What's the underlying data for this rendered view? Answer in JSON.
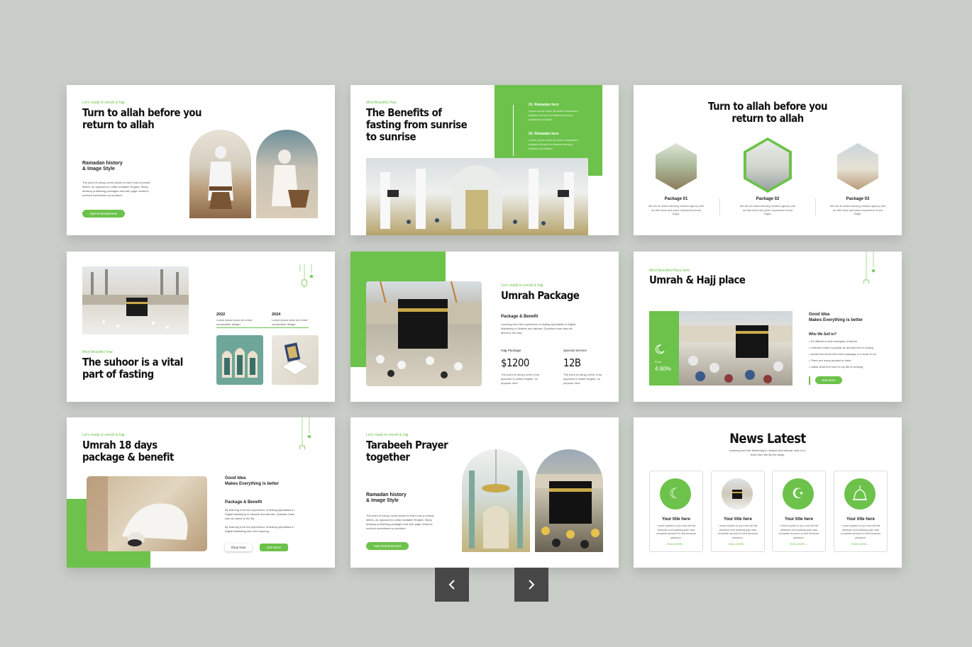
{
  "slides": {
    "s1": {
      "kicker": "Let's ready to umrah & hajj",
      "title": [
        "Turn to allah before you",
        "return to allah"
      ],
      "sub": [
        "Ramadan history",
        "& Image Style"
      ],
      "body": "The point of using Lorem Ipsum is that it has a normal letters, as opposed to unlike readable English. Many desktop publishing packages and web page versions evolved sometimes by accident.",
      "button": "Start Entertainment"
    },
    "s2": {
      "kicker": "Most Beautiful Year",
      "title": [
        "The Benefits of",
        "fasting from sunrise",
        "to sunrise"
      ],
      "item1_title": "01. Ramadan here",
      "item1_text": "Lorem ipsum dolor sit amet consectetur adipisci elit sed do eiusmod tempor incididunt ut labore",
      "item2_title": "02. Ramadan here",
      "item2_text": "Lorem ipsum dolor sit amet consectetur adipisci elit sed do eiusmod tempor incididunt ut labore"
    },
    "s3": {
      "title": [
        "Turn to allah before you",
        "return to allah"
      ],
      "packages": [
        {
          "label": "Package 01",
          "text": "We are an award winning creative agency with an elite team and years experience brand forget."
        },
        {
          "label": "Package 02",
          "text": "We are an award winning creative agency with an elite team and years experience brand forget."
        },
        {
          "label": "Package 03",
          "text": "We are an award winning creative agency with an elite team and years experience brand forget."
        }
      ]
    },
    "s4": {
      "year1": "2022",
      "year1_text": "Lorem ipsum dolor sit a mist consectetur design",
      "year2": "2024",
      "year2_text": "Lorem ipsum dolor sit a mist consectetur design",
      "kicker": "Most Beautiful Year",
      "title": [
        "The suhoor is a vital",
        "part of fasting"
      ]
    },
    "s5": {
      "kicker": "Let's ready to umrah & hajj",
      "title": [
        "Umrah Package"
      ],
      "sub": "Package & Benefit",
      "body": "Learning from the experience of testing specialists in Digital Marketing in Ukraine and abroad. Question learn was we about to the way.",
      "col1_label": "Hajj Package",
      "col1_value": "$1200",
      "col1_text": "The point of using Lorem ot as opposed to unlike English. on purpose here.",
      "col2_label": "Special Service",
      "col2_value": "12B",
      "col2_text": "The point of using Lorem ot as opposed to unlike English. on purpose here."
    },
    "s6": {
      "kicker": "Most Beautiful Place here",
      "title": [
        "Umrah & Hajj place"
      ],
      "stat_label": "From",
      "stat_value": "4.60%",
      "sub": [
        "Good Idea",
        "Makes Everything is better"
      ],
      "who": "Who We Sell to?",
      "bullets": [
        "It's difficult to find examples of before",
        "Lettraset make it popular as dummy text in coding",
        "across the lorem this lorem passage in a book of col",
        "There are many product in there",
        "Latest what erto here in my life to working"
      ],
      "button": "See More"
    },
    "s7": {
      "kicker": "Let's ready to umrah & hajj",
      "title": [
        "Umrah 18 days",
        "package & benefit"
      ],
      "sub": [
        "Good Idea",
        "Makes Everything is better"
      ],
      "sub2": "Package & Benefit",
      "body1": "By learning from the experience of testing specialists in Digital Marketing in Ukraine and abroad. Question learn was we about to the By",
      "body2": "By learning from the experience of testing specialists in Digital Marketing into here learning.",
      "button1": "Shop Now",
      "button2": "See More"
    },
    "s8": {
      "kicker": "Let's ready to umrah & hajj",
      "title": [
        "Tarabeeh Prayer",
        "together"
      ],
      "sub": [
        "Ramadan history",
        "& Image Style"
      ],
      "body": "The point of using Lorem Ipsum is that it has a normal letters, as opposed to unlike readable English. Many desktop publishing packages and web page versions evolved sometimes by accident.",
      "button": "Start Entertainment"
    },
    "s9": {
      "title": "News Latest",
      "subtitle": "learning from the Marketing in ukraine and abroad. able to in build from the By the away.",
      "cards": [
        {
          "title": "Your title here",
          "text": "I must explain to you how all this pleasure and praising pain was complete account of and because pleasure.",
          "more": "READ MORE →"
        },
        {
          "title": "Your title here",
          "text": "I must explain to you how all this pleasure and praising pain was complete account of and because pleasure.",
          "more": "READ MORE →"
        },
        {
          "title": "Your title here",
          "text": "I must explain to you how all this pleasure and praising pain was complete account of and because pleasure.",
          "more": "READ MORE →"
        },
        {
          "title": "Your title here",
          "text": "I must explain to you how all this pleasure and praising pain was complete account of and because pleasure.",
          "more": "READ MORE →"
        }
      ]
    }
  },
  "nav": {
    "prev_icon": "chevron-left-icon",
    "next_icon": "chevron-right-icon",
    "prev": "‹",
    "next": "›"
  },
  "colors": {
    "accent": "#6cc24a",
    "background": "#c9cdc8",
    "nav": "#474747"
  }
}
